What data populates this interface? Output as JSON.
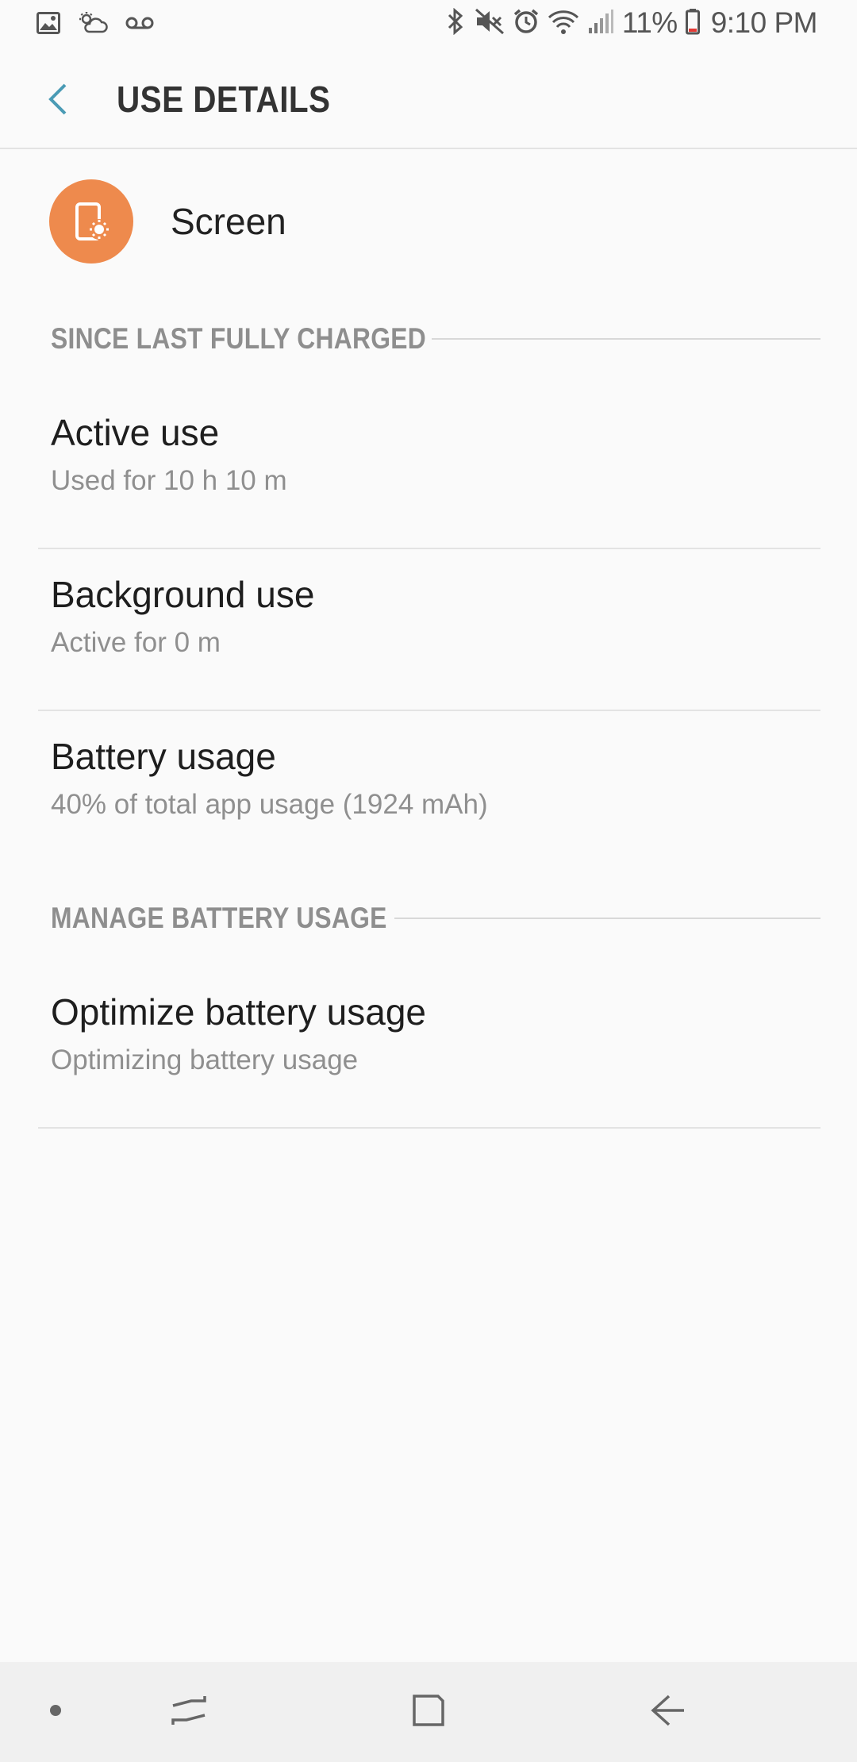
{
  "status_bar": {
    "icons_left": [
      "gallery-icon",
      "weather-icon",
      "voicemail-icon"
    ],
    "icons_right": [
      "bluetooth-icon",
      "mute-icon",
      "alarm-icon",
      "wifi-icon",
      "signal-icon"
    ],
    "battery_percent": "11%",
    "time": "9:10 PM"
  },
  "app_bar": {
    "title": "USE DETAILS",
    "back_icon": "back-arrow-icon"
  },
  "app": {
    "name": "Screen",
    "icon": "screen-brightness-icon",
    "icon_color": "#ee8a4d"
  },
  "sections": {
    "since_charged": "SINCE LAST FULLY CHARGED",
    "manage": "MANAGE BATTERY USAGE"
  },
  "items": [
    {
      "title": "Active use",
      "subtitle": "Used for 10 h 10 m"
    },
    {
      "title": "Background use",
      "subtitle": "Active for 0 m"
    },
    {
      "title": "Battery usage",
      "subtitle": "40% of total app usage (1924 mAh)"
    },
    {
      "title": "Optimize battery usage",
      "subtitle": "Optimizing battery usage"
    }
  ],
  "nav_bar": {
    "buttons": [
      "dot-icon",
      "recents-icon",
      "home-icon",
      "back-icon"
    ]
  },
  "colors": {
    "accent": "#4a9bb5",
    "background": "#fafafa",
    "nav_background": "#f0f0f0"
  }
}
